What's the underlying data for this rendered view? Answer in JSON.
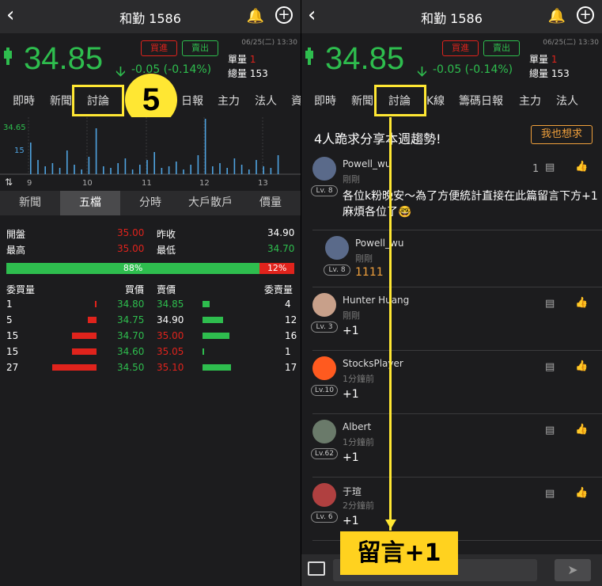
{
  "stock": {
    "title": "和勤 1586",
    "price": "34.85",
    "change": "-0.05 (-0.14%)",
    "datetime": "06/25(二) 13:30",
    "buy_label": "買進",
    "sell_label": "賣出",
    "unit_vol_label": "單量",
    "unit_vol_value": "1",
    "total_vol_label": "總量",
    "total_vol_value": "153"
  },
  "left": {
    "tabs": [
      "即時",
      "新聞",
      "討論",
      "日報",
      "主力",
      "法人",
      "資"
    ],
    "step_number": "5",
    "chart_data": {
      "type": "bar",
      "ytick_labels": [
        "34.65",
        "15"
      ],
      "x_tick_labels": [
        "9",
        "10",
        "11",
        "12",
        "13"
      ]
    },
    "subtabs": [
      "新聞",
      "五檔",
      "分時",
      "大戶散戶",
      "價量"
    ],
    "summary": {
      "open_label": "開盤",
      "open_value": "35.00",
      "prev_label": "昨收",
      "prev_value": "34.90",
      "high_label": "最高",
      "high_value": "35.00",
      "low_label": "最低",
      "low_value": "34.70"
    },
    "ratio_green": "88%",
    "ratio_red": "12%",
    "ratio_green_pct": 88,
    "book_headers": [
      "委買量",
      "買價",
      "賣價",
      "委賣量"
    ],
    "book": [
      {
        "bid_qty": "1",
        "bid": "34.80",
        "ask": "34.85",
        "ask_qty": "4",
        "bid_frac": 0.04,
        "ask_frac": 0.24
      },
      {
        "bid_qty": "5",
        "bid": "34.75",
        "ask": "34.90",
        "ask_qty": "12",
        "bid_frac": 0.19,
        "ask_frac": 0.71
      },
      {
        "bid_qty": "15",
        "bid": "34.70",
        "ask": "35.00",
        "ask_qty": "16",
        "bid_frac": 0.56,
        "ask_frac": 0.94
      },
      {
        "bid_qty": "15",
        "bid": "34.60",
        "ask": "35.05",
        "ask_qty": "1",
        "bid_frac": 0.56,
        "ask_frac": 0.06
      },
      {
        "bid_qty": "27",
        "bid": "34.50",
        "ask": "35.10",
        "ask_qty": "17",
        "bid_frac": 1.0,
        "ask_frac": 1.0
      }
    ]
  },
  "right": {
    "tabs": [
      "即時",
      "新聞",
      "討論",
      "K線",
      "籌碼日報",
      "主力",
      "法人"
    ],
    "headline": "4人跪求分享本週趨勢!",
    "metoo_label": "我也想求",
    "comments": [
      {
        "name": "Powell_wu",
        "time": "剛剛",
        "text": "各位k粉晚安～為了方便統計直接在此篇留言下方+1麻煩各位了🤓",
        "level": "Lv. 8",
        "reply_count": "1"
      },
      {
        "name": "Powell_wu",
        "time": "剛剛",
        "text": "1111",
        "level": "Lv. 8"
      },
      {
        "name": "Hunter Huang",
        "time": "剛剛",
        "text": "+1",
        "level": "Lv. 3"
      },
      {
        "name": "StocksPlayer",
        "time": "1分鐘前",
        "text": "+1",
        "level": "Lv.10"
      },
      {
        "name": "Albert",
        "time": "1分鐘前",
        "text": "+1",
        "level": "Lv.62"
      },
      {
        "name": "于瑄",
        "time": "2分鐘前",
        "text": "+1",
        "level": "Lv. 6"
      }
    ],
    "callout": "留言+1"
  },
  "colors": {
    "up": "#e0231c",
    "down": "#2ebd4e",
    "highlight": "#ffe733"
  }
}
